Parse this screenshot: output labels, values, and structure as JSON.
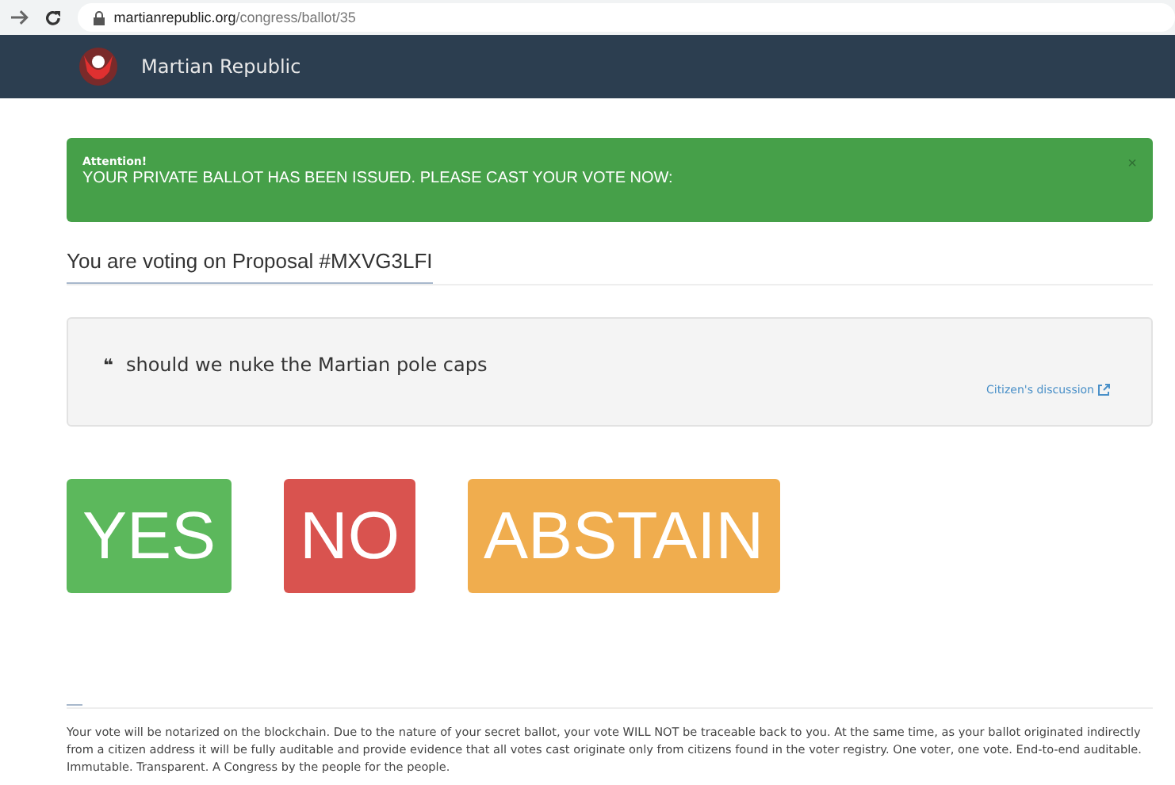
{
  "browser": {
    "url": "**martianrepublic.org**/congress/ballot/35"
  },
  "navbar": {
    "brand": "Martian Republic"
  },
  "alert": {
    "title": "Attention!",
    "message": "YOUR PRIVATE BALLOT HAS BEEN ISSUED. PLEASE CAST YOUR VOTE NOW:",
    "close": "×"
  },
  "heading": "You are voting on Proposal #MXVG3LFI",
  "proposal": {
    "quote_mark": "❝",
    "text": "should we nuke the Martian pole caps",
    "link": "Citizen's discussion"
  },
  "vote_buttons": [
    {
      "label": "YES",
      "kind": "yes"
    },
    {
      "label": "NO",
      "kind": "no"
    },
    {
      "label": "ABSTAIN",
      "kind": "abstain"
    }
  ],
  "footer": "Your vote will be notarized on the blockchain. Due to the nature of your secret ballot, your vote WILL NOT be traceable back to you. At the same time, as your ballot originated indirectly from a citizen address it will be fully auditable and provide evidence that all votes cast originate only from citizens found in the voter registry. One voter, one vote. End-to-end auditable. Immutable. Transparent. A Congress by the people for the people."
}
